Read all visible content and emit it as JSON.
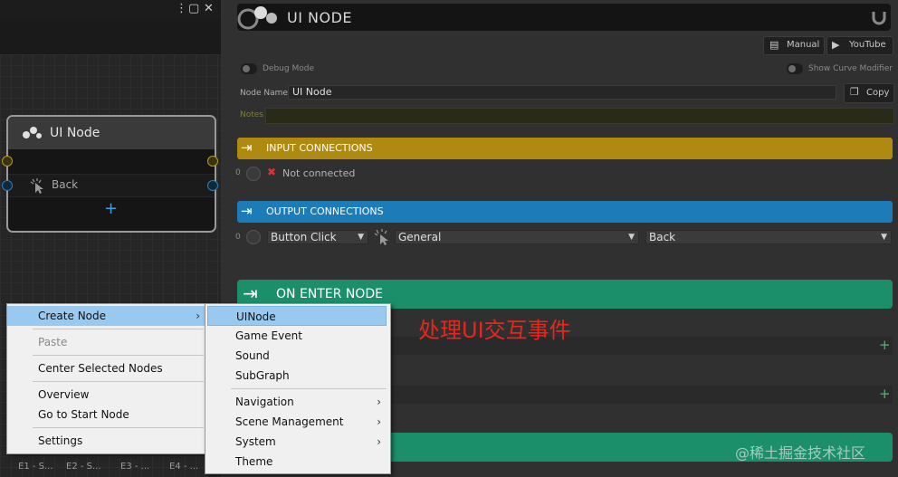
{
  "graph": {
    "node": {
      "title": "UI Node",
      "port_label": "Back",
      "add_symbol": "+"
    },
    "bottom_nodes": [
      "E1 - S...",
      "E2 - S...",
      "E3 - ...",
      "E4 - ..."
    ],
    "window_icons": [
      "kebab-menu-icon",
      "maximize-icon",
      "close-icon"
    ]
  },
  "inspector": {
    "header_title": "UI NODE",
    "manual_label": "Manual",
    "youtube_label": "YouTube",
    "debug_mode_label": "Debug Mode",
    "show_curve_label": "Show Curve Modifier",
    "node_name_label": "Node Name",
    "node_name_value": "UI Node",
    "copy_label": "Copy",
    "notes_label": "Notes",
    "input_section": {
      "title": "INPUT CONNECTIONS",
      "color": "#b08a10",
      "index": "0",
      "status": "Not connected"
    },
    "output_section": {
      "title": "OUTPUT CONNECTIONS",
      "color": "#1d7bb8",
      "index": "0",
      "trigger": "Button Click",
      "category": "General",
      "target": "Back"
    },
    "enter_section": {
      "title": "ON ENTER NODE",
      "color": "#1a8f6a"
    },
    "annotation": "处理UI交互事件",
    "watermark": "@稀土掘金技术社区"
  },
  "context_menu": {
    "items": [
      "Create Node",
      "Paste",
      "Center Selected Nodes",
      "Overview",
      "Go to Start Node",
      "Settings"
    ],
    "submenu": [
      "UINode",
      "Game Event",
      "Sound",
      "SubGraph",
      "Navigation",
      "Scene Management",
      "System",
      "Theme"
    ],
    "submenu_arrow": "›"
  }
}
